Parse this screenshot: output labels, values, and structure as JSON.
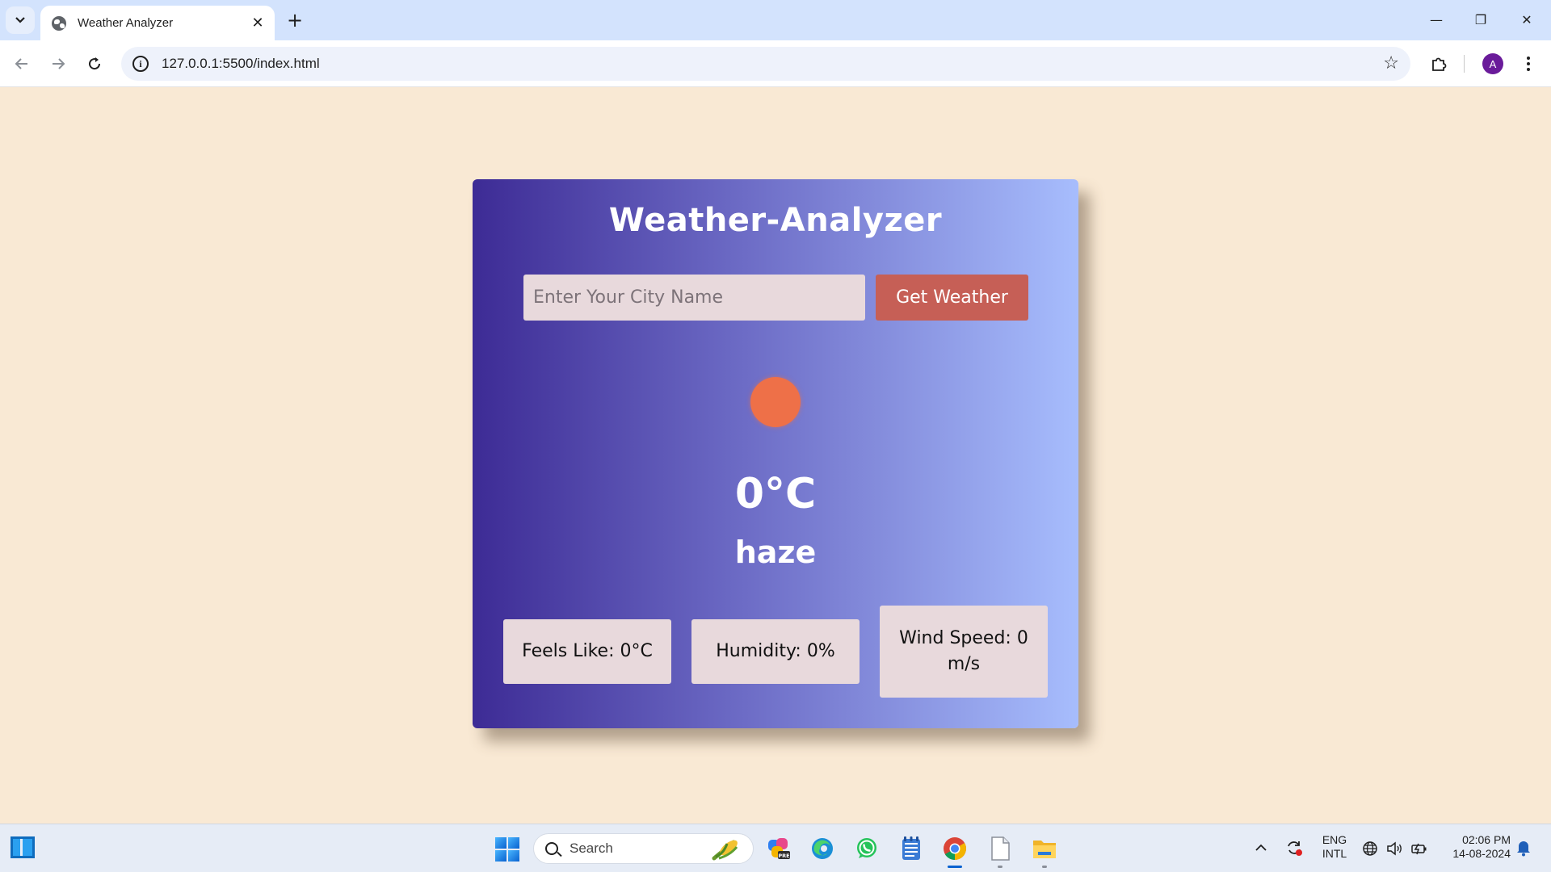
{
  "browser": {
    "tab_title": "Weather Analyzer",
    "tab_close": "✕",
    "new_tab": "+",
    "url": "127.0.0.1:5500/index.html",
    "site_info": "i",
    "profile_initial": "A",
    "window_controls": {
      "minimize": "—",
      "restore": "❐",
      "close": "✕"
    }
  },
  "app": {
    "title": "Weather-Analyzer",
    "city_placeholder": "Enter Your City Name",
    "get_weather_label": "Get Weather",
    "temperature": "0°C",
    "description": "haze",
    "feels_like": "Feels Like: 0°C",
    "humidity": "Humidity: 0%",
    "wind_speed": "Wind Speed: 0 m/s",
    "icon_name": "sun-icon",
    "colors": {
      "page_bg": "#f9e9d4",
      "gradient_start": "#3d2b95",
      "gradient_end": "#a7bdfd",
      "button": "#c65f56",
      "sun": "#ee7048",
      "stat_box": "#e8d9dc"
    }
  },
  "taskbar": {
    "search_label": "Search",
    "language_top": "ENG",
    "language_bottom": "INTL",
    "time": "02:06 PM",
    "date": "14-08-2024",
    "pinned_apps": [
      "copilot-icon",
      "edge-icon",
      "whatsapp-icon",
      "notepad-icon",
      "chrome-icon",
      "file-icon",
      "file-explorer-icon"
    ]
  }
}
